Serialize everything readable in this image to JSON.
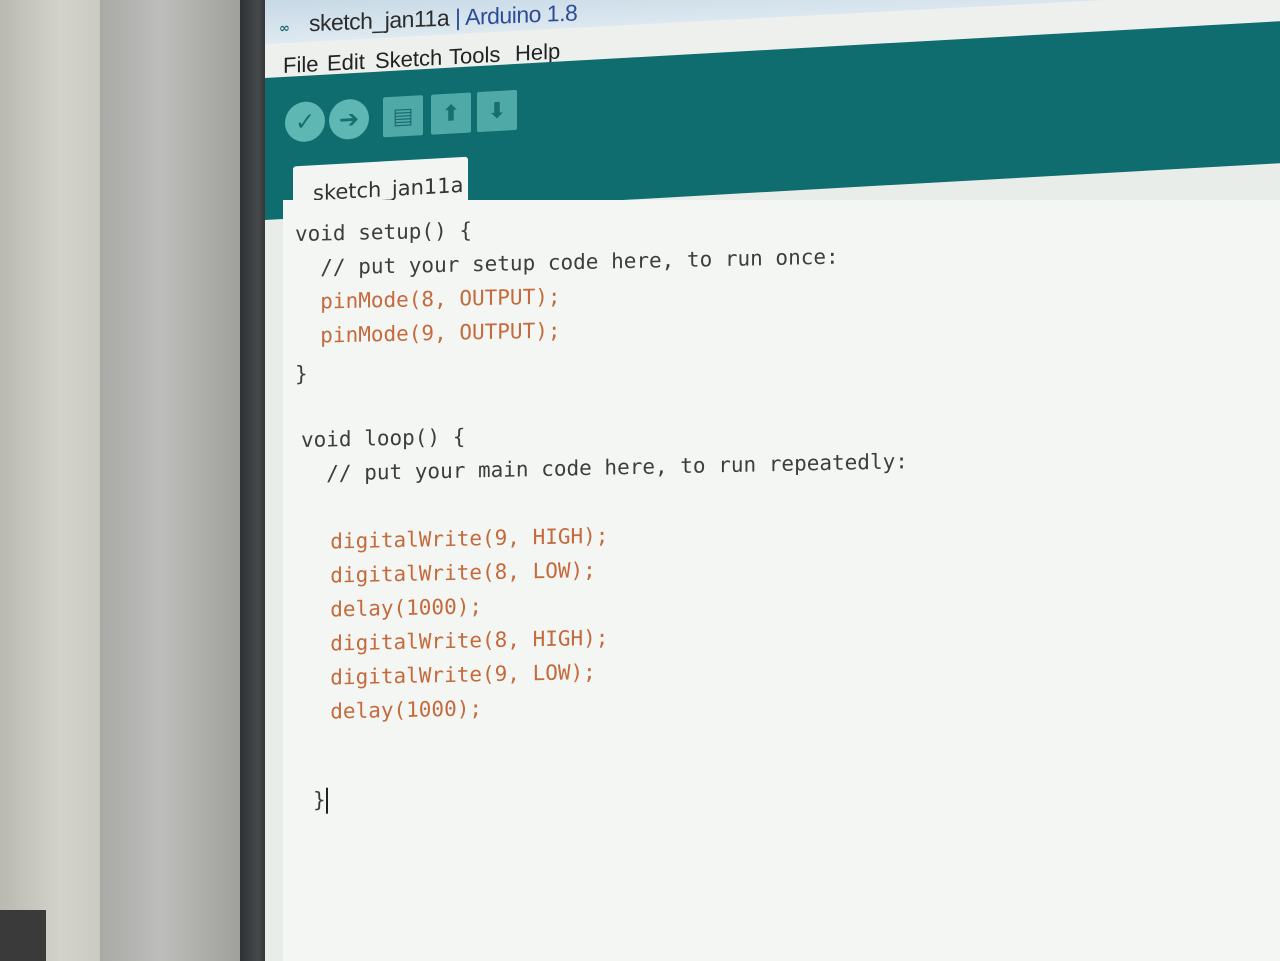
{
  "window": {
    "title": "sketch_jan11a",
    "separator": "|",
    "app_name": "Arduino 1.8"
  },
  "menu": {
    "items": [
      "File",
      "Edit",
      "Sketch",
      "Tools",
      "Help"
    ]
  },
  "toolbar": {
    "buttons": [
      {
        "name": "verify",
        "icon": "check-icon",
        "glyph": "✓"
      },
      {
        "name": "upload",
        "icon": "arrow-right-icon",
        "glyph": "➔"
      },
      {
        "name": "new",
        "icon": "document-icon",
        "glyph": "▤"
      },
      {
        "name": "open",
        "icon": "arrow-up-icon",
        "glyph": "⬆"
      },
      {
        "name": "save",
        "icon": "arrow-down-icon",
        "glyph": "⬇"
      }
    ]
  },
  "tab": {
    "label": "sketch_jan11a"
  },
  "code": {
    "lines": [
      "void setup() {",
      "  // put your setup code here, to run once:",
      "  pinMode(8, OUTPUT);",
      "  pinMode(9, OUTPUT);",
      "}",
      "",
      "void loop() {",
      "  // put your main code here, to run repeatedly:",
      "",
      "  digitalWrite(9, HIGH);",
      "  digitalWrite(8, LOW);",
      "  delay(1000);",
      "  digitalWrite(8, HIGH);",
      "  digitalWrite(9, LOW);",
      "  delay(1000);",
      "",
      "",
      "}"
    ]
  },
  "colors": {
    "toolbar": "#0f6d70",
    "function": "#c46a3c",
    "constant": "#1e8a8e"
  }
}
